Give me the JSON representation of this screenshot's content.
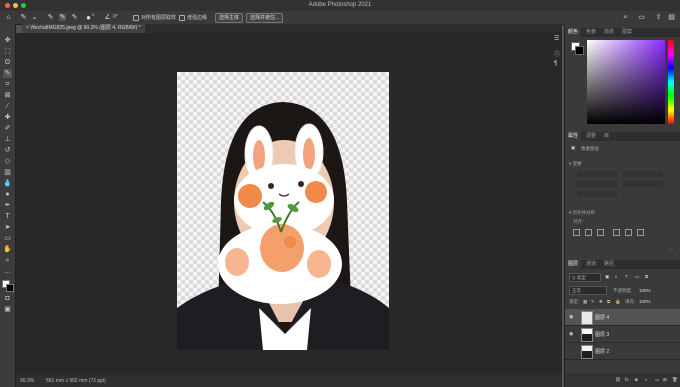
{
  "window": {
    "title": "Adobe Photoshop 2021"
  },
  "options_bar": {
    "size": "0",
    "angle": "0°",
    "sample_all_layers_label": "对所有图层取样",
    "enhance_edge_label": "增强边缘",
    "select_subject_label": "选择主体",
    "select_and_mask_label": "选择并遮住..."
  },
  "document": {
    "tab_label": "WechatIMG825.jpeg @ 90.3% (图层 4, RGB/8#) *"
  },
  "status_bar": {
    "zoom": "90.3%",
    "info": "561 mm x 902 mm (72 ppi)"
  },
  "color_panel": {
    "tabs": [
      "颜色",
      "色板",
      "渐变",
      "图案"
    ]
  },
  "properties_panel": {
    "tabs": [
      "属性",
      "调整",
      "库"
    ],
    "kind_label": "像素图层",
    "transform_label": "变换",
    "align_label": "对齐并分布",
    "align_sub": "对齐:"
  },
  "layers_panel": {
    "tabs": [
      "图层",
      "通道",
      "路径"
    ],
    "filter_label": "Q 类型",
    "blend_mode": "正常",
    "opacity_label": "不透明度:",
    "opacity_value": "100%",
    "lock_label": "锁定:",
    "fill_label": "填充:",
    "fill_value": "100%",
    "layers": [
      {
        "name": "图层 4",
        "selected": true
      },
      {
        "name": "图层 3",
        "selected": false
      },
      {
        "name": "图层 2",
        "selected": false
      }
    ]
  },
  "colors": {
    "ui_dark": "#323232",
    "accent_orange": "#f0894a",
    "hue_top": "#ff00ff",
    "picker_purple": "#7a2cff"
  }
}
